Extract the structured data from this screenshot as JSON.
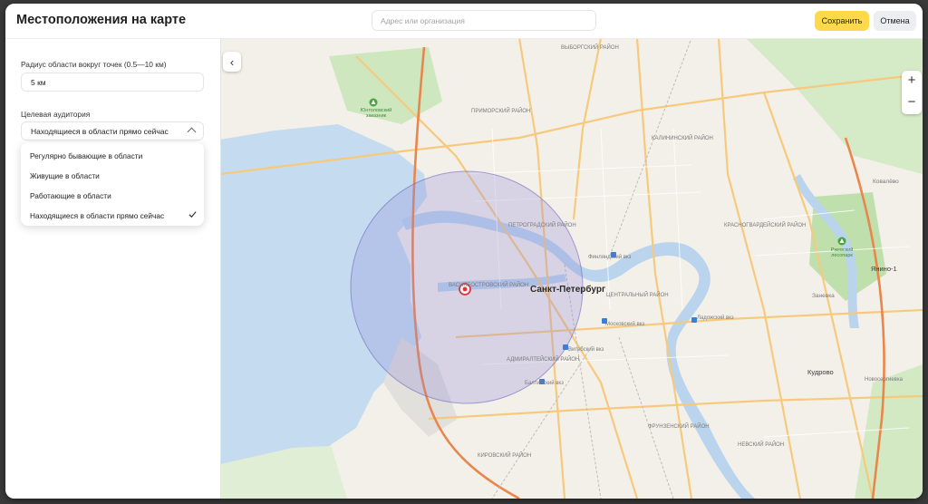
{
  "header": {
    "title": "Местоположения на карте",
    "search_placeholder": "Адрес или организация",
    "save_label": "Сохранить",
    "cancel_label": "Отмена"
  },
  "sidebar": {
    "radius_label": "Радиус области вокруг точек (0.5—10 км)",
    "radius_value": "5 км",
    "audience_label": "Целевая аудитория",
    "audience_selected": "Находящиеся в области прямо сейчас",
    "options": [
      {
        "label": "Регулярно бывающие в области",
        "selected": false
      },
      {
        "label": "Живущие в области",
        "selected": false
      },
      {
        "label": "Работающие в области",
        "selected": false
      },
      {
        "label": "Находящиеся в области прямо сейчас",
        "selected": true
      }
    ]
  },
  "map": {
    "collapse_icon": "‹",
    "zoom_in": "+",
    "zoom_out": "−",
    "labels": {
      "city": "Санкт-Петербург",
      "yanino": "Янино-1",
      "kudrovo": "Кудрово",
      "zanevka": "Заневка",
      "kovalevo": "Ковалёво",
      "novosergievka": "Новосергиевка",
      "primorsky": "ПРИМОРСКИЙ РАЙОН",
      "vyborgsky": "ВЫБОРГСКИЙ РАЙОН",
      "kalininsky": "КАЛИНИНСКИЙ РАЙОН",
      "krasnogvardeysky": "КРАСНОГВАРДЕЙСКИЙ РАЙОН",
      "petrogradsky": "ПЕТРОГРАДСКИЙ РАЙОН",
      "vasileostrovsky": "ВАСИЛЕОСТРОВСКИЙ РАЙОН",
      "centralny": "ЦЕНТРАЛЬНЫЙ РАЙОН",
      "admiralteysky": "АДМИРАЛТЕЙСКИЙ РАЙОН",
      "frunzensky": "ФРУНЗЕНСКИЙ РАЙОН",
      "kirovsky": "КИРОВСКИЙ РАЙОН",
      "nevsky": "НЕВСКИЙ РАЙОН",
      "finlyandsky": "Финляндский вкз",
      "moskovsky": "Московский вкз",
      "ladozhsky": "Ладожский вкз",
      "vitebsky": "Витебский вкз",
      "baltiysky": "Балтийский вкз",
      "yuntolovsky": "Юнтоловский заказник",
      "rzhevsky": "Ржевский лесопарк"
    }
  }
}
